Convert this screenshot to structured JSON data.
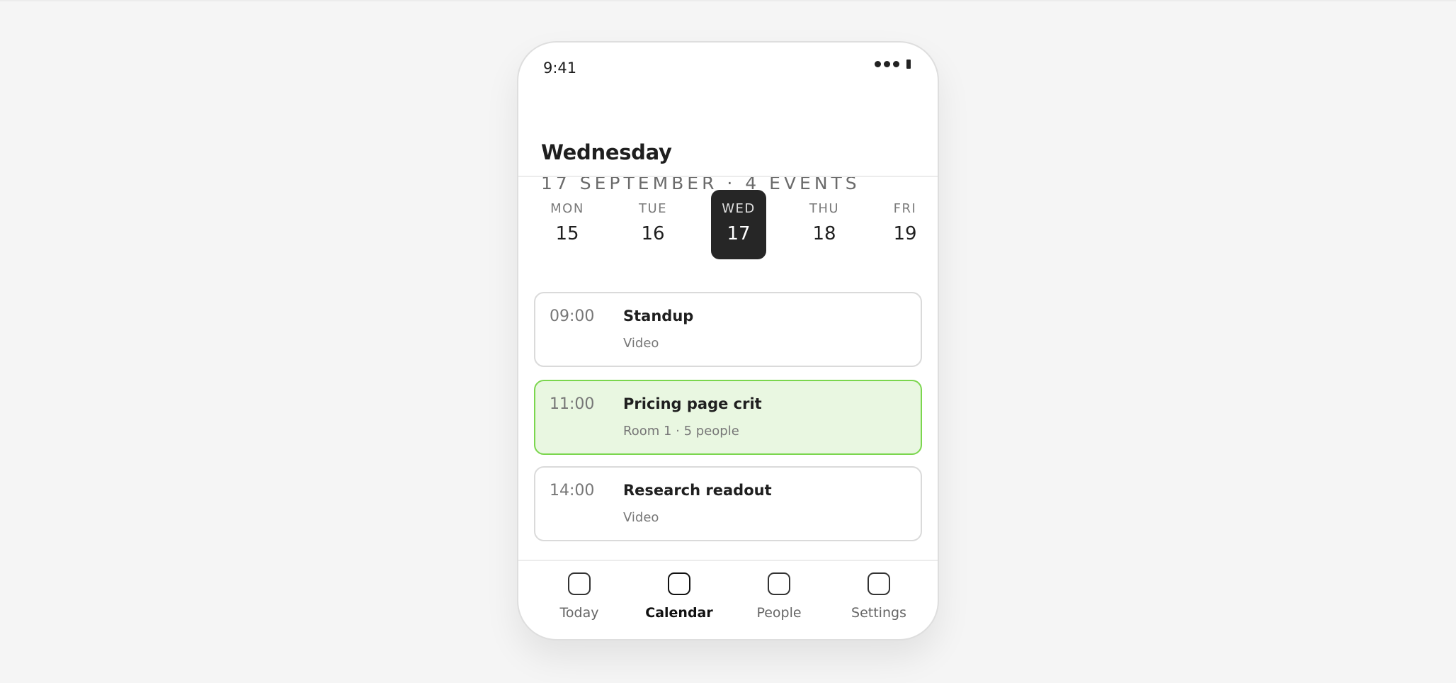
{
  "status_bar": {
    "time": "9:41",
    "signal_icon": "signal-dots-icon",
    "battery_icon": "battery-icon"
  },
  "header": {
    "title": "Wednesday",
    "subtitle": "17 SEPTEMBER · 4 EVENTS"
  },
  "days": [
    {
      "name": "MON",
      "num": "15",
      "selected": false
    },
    {
      "name": "TUE",
      "num": "16",
      "selected": false
    },
    {
      "name": "WED",
      "num": "17",
      "selected": true
    },
    {
      "name": "THU",
      "num": "18",
      "selected": false
    },
    {
      "name": "FRI",
      "num": "19",
      "selected": false
    }
  ],
  "events": [
    {
      "time": "09:00",
      "title": "Standup",
      "meta": "Video",
      "highlighted": false
    },
    {
      "time": "11:00",
      "title": "Pricing page crit",
      "meta": "Room 1 · 5 people",
      "highlighted": true
    },
    {
      "time": "14:00",
      "title": "Research readout",
      "meta": "Video",
      "highlighted": false
    }
  ],
  "tabs": [
    {
      "label": "Today",
      "icon": "today-icon",
      "active": false
    },
    {
      "label": "Calendar",
      "icon": "calendar-icon",
      "active": true
    },
    {
      "label": "People",
      "icon": "people-icon",
      "active": false
    },
    {
      "label": "Settings",
      "icon": "settings-icon",
      "active": false
    }
  ],
  "colors": {
    "background": "#f5f5f5",
    "selected_day": "#262626",
    "highlight_fill": "#e9f7e1",
    "highlight_border": "#7bd64e"
  }
}
